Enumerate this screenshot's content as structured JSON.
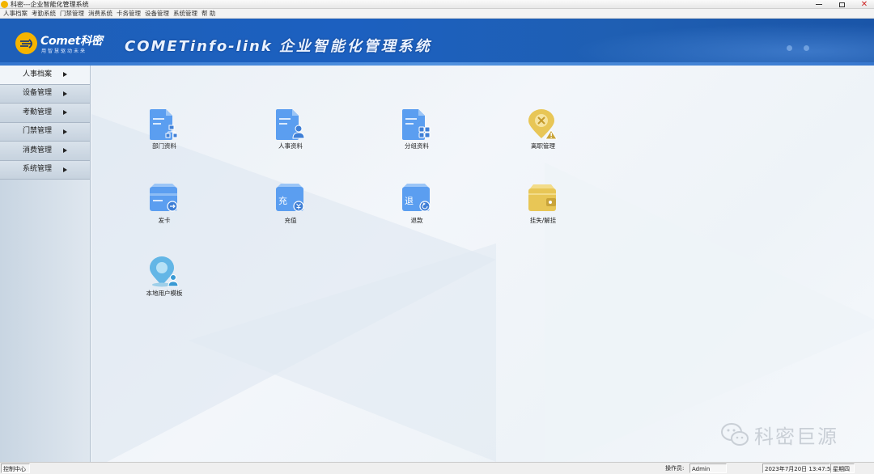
{
  "window": {
    "title": "科密---企业智能化管理系统",
    "buttons": {
      "close": "✕"
    }
  },
  "menubar": [
    "人事档案",
    "考勤系统",
    "门禁管理",
    "消费系统",
    "卡务管理",
    "设备管理",
    "系统管理",
    "帮 助"
  ],
  "banner": {
    "logo_text": "Comet科密",
    "logo_slogan": "用智慧驱动未来",
    "title_en": "COMETinfo-link",
    "title_cn": "企业智能化管理系统"
  },
  "sidebar": {
    "items": [
      {
        "label": "人事档案",
        "active": true
      },
      {
        "label": "设备管理",
        "active": false
      },
      {
        "label": "考勤管理",
        "active": false
      },
      {
        "label": "门禁管理",
        "active": false
      },
      {
        "label": "消费管理",
        "active": false
      },
      {
        "label": "系统管理",
        "active": false
      }
    ]
  },
  "tiles": [
    {
      "label": "部门资料",
      "icon": "department-doc-icon"
    },
    {
      "label": "人事资料",
      "icon": "personnel-doc-icon"
    },
    {
      "label": "分组资料",
      "icon": "group-doc-icon"
    },
    {
      "label": "离职管理",
      "icon": "resignation-pin-icon"
    },
    {
      "label": "发卡",
      "icon": "issue-card-icon"
    },
    {
      "label": "充值",
      "icon": "recharge-card-icon",
      "glyph": "充"
    },
    {
      "label": "退款",
      "icon": "refund-card-icon",
      "glyph": "退"
    },
    {
      "label": "挂失/解挂",
      "icon": "report-loss-wallet-icon"
    },
    {
      "label": "本地用户模板",
      "icon": "local-user-pin-icon"
    }
  ],
  "watermark": {
    "text": "科密巨源",
    "icon": "wechat-icon"
  },
  "statusbar": {
    "control_center": "控制中心",
    "operator_label": "操作员:",
    "operator_value": "Admin",
    "datetime": "2023年7月20日 13:47:57",
    "weekday": "星期四"
  },
  "colors": {
    "banner": "#1c60c0",
    "doc_icon": "#5b9ef0",
    "warning_icon": "#e8c656",
    "pin_icon": "#63b6e6",
    "logo": "#f5b400"
  }
}
